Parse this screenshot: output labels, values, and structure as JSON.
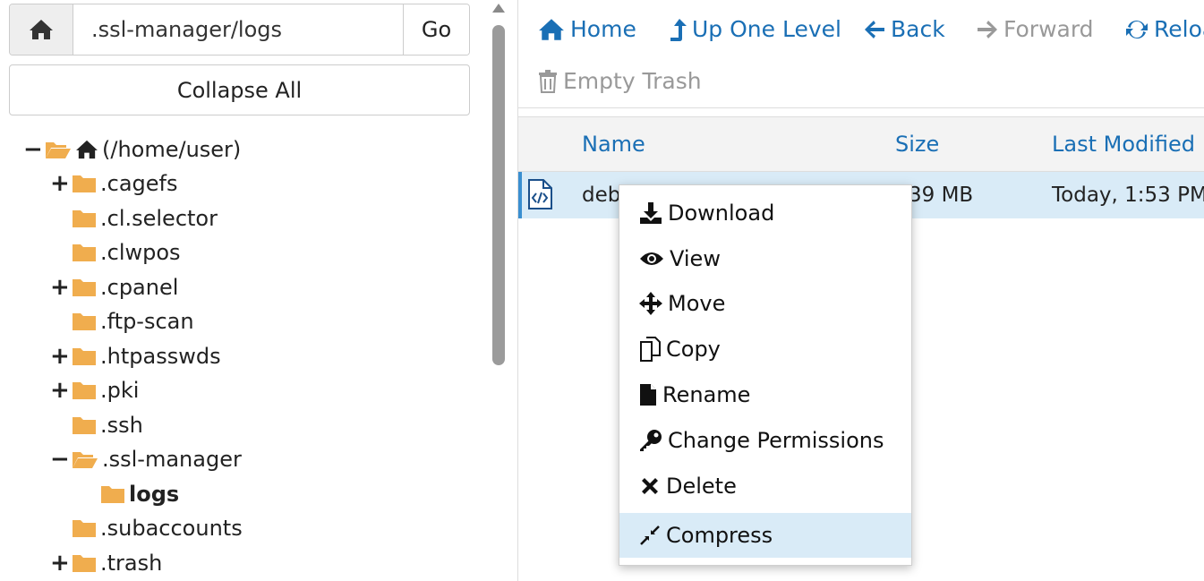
{
  "path": {
    "value": ".ssl-manager/logs",
    "go_label": "Go"
  },
  "sidebar": {
    "collapse_label": "Collapse All",
    "tree": [
      {
        "label": "(/home/user)",
        "toggle": "−",
        "open": true
      },
      {
        "label": ".cagefs",
        "toggle": "+"
      },
      {
        "label": ".cl.selector",
        "toggle": ""
      },
      {
        "label": ".clwpos",
        "toggle": ""
      },
      {
        "label": ".cpanel",
        "toggle": "+"
      },
      {
        "label": ".ftp-scan",
        "toggle": ""
      },
      {
        "label": ".htpasswds",
        "toggle": "+"
      },
      {
        "label": ".pki",
        "toggle": "+"
      },
      {
        "label": ".ssh",
        "toggle": ""
      },
      {
        "label": ".ssl-manager",
        "toggle": "−",
        "open": true
      },
      {
        "label": "logs",
        "toggle": "",
        "selected": true
      },
      {
        "label": ".subaccounts",
        "toggle": ""
      },
      {
        "label": ".trash",
        "toggle": "+"
      }
    ]
  },
  "toolbar": {
    "home": "Home",
    "up": "Up One Level",
    "back": "Back",
    "forward": "Forward",
    "reload": "Reloa",
    "empty_trash": "Empty Trash"
  },
  "table": {
    "columns": {
      "name": "Name",
      "size": "Size",
      "modified": "Last Modified"
    },
    "rows": [
      {
        "name": "deb",
        "size": "39 MB",
        "modified": "Today, 1:53 PM"
      }
    ]
  },
  "context_menu": {
    "items": [
      "Download",
      "View",
      "Move",
      "Copy",
      "Rename",
      "Change Permissions",
      "Delete",
      "Compress"
    ],
    "active": "Compress"
  },
  "colors": {
    "link": "#1a6fb5",
    "folder": "#f0ad4e",
    "selected_row": "#d9ebf7",
    "row_accent": "#3a8fd0",
    "disabled": "#999999"
  }
}
